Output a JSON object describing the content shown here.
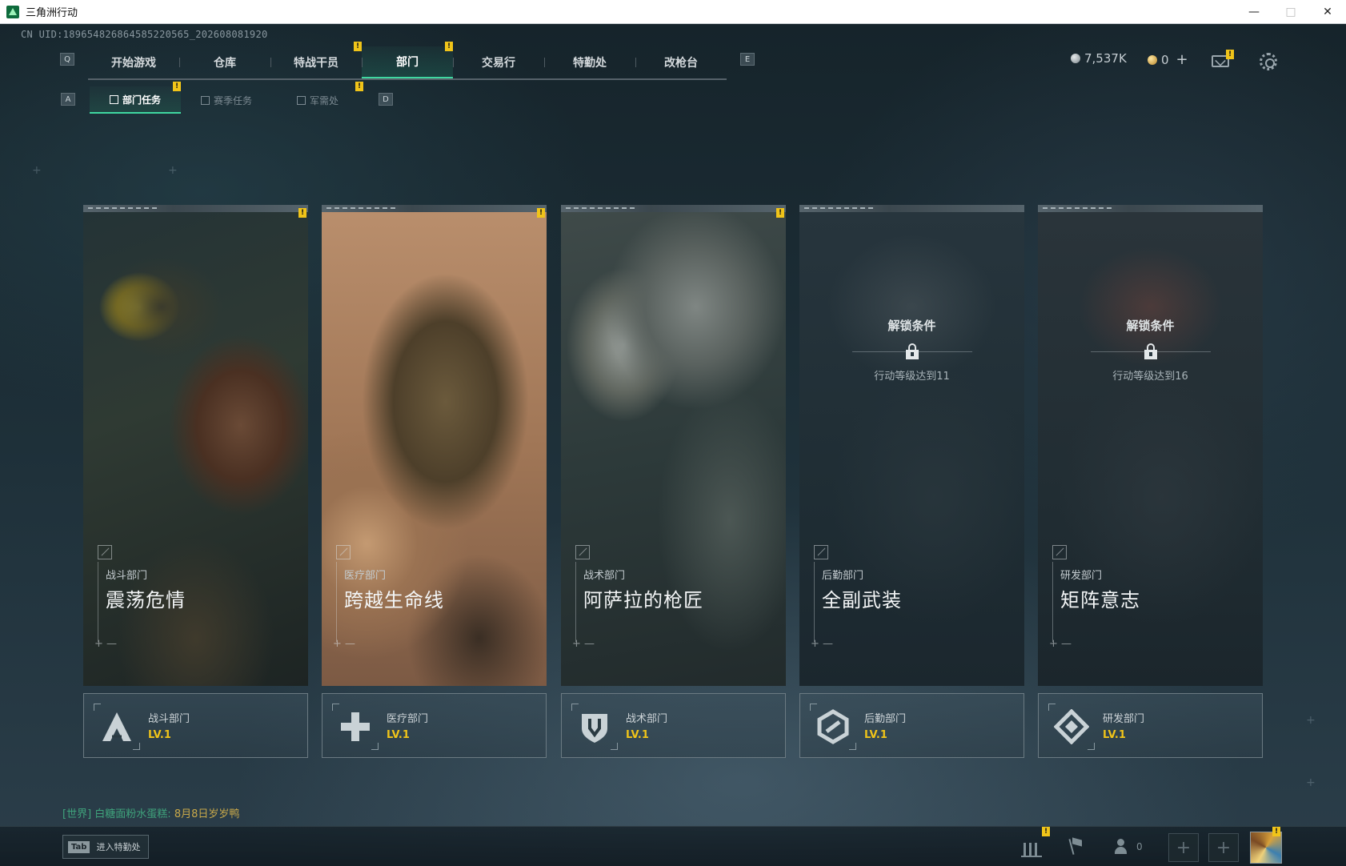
{
  "window": {
    "title": "三角洲行动",
    "minimize": "—",
    "maximize": "□",
    "close": "✕"
  },
  "uid": "CN UID:18965482686458522056​5_202608081920",
  "keys": {
    "prev_main": "Q",
    "next_main": "E",
    "prev_sub": "A",
    "next_sub": "D"
  },
  "main_nav": {
    "tabs": [
      {
        "label": "开始游戏"
      },
      {
        "label": "仓库"
      },
      {
        "label": "特战干员"
      },
      {
        "label": "部门"
      },
      {
        "label": "交易行"
      },
      {
        "label": "特勤处"
      },
      {
        "label": "改枪台"
      }
    ],
    "active_index": 3
  },
  "sub_nav": {
    "tabs": [
      {
        "label": "部门任务"
      },
      {
        "label": "赛季任务"
      },
      {
        "label": "军需处"
      }
    ],
    "active_index": 0
  },
  "badge_mark": "!",
  "currency": {
    "silver": "7,537K",
    "gold": "0",
    "add": "+"
  },
  "cards": [
    {
      "dept": "战斗部门",
      "title": "震荡危情"
    },
    {
      "dept": "医疗部门",
      "title": "跨越生命线"
    },
    {
      "dept": "战术部门",
      "title": "阿萨拉的枪匠"
    },
    {
      "dept": "后勤部门",
      "title": "全副武装",
      "lock_title": "解锁条件",
      "lock_condition": "行动等级达到11"
    },
    {
      "dept": "研发部门",
      "title": "矩阵意志",
      "lock_title": "解锁条件",
      "lock_condition": "行动等级达到16"
    }
  ],
  "levels": [
    {
      "name": "战斗部门",
      "level": "LV.1"
    },
    {
      "name": "医疗部门",
      "level": "LV.1"
    },
    {
      "name": "战术部门",
      "level": "LV.1"
    },
    {
      "name": "后勤部门",
      "level": "LV.1"
    },
    {
      "name": "研发部门",
      "level": "LV.1"
    }
  ],
  "chat": {
    "channel": "[世界]",
    "name": "白糖面粉水蛋糕:",
    "message": "8月8日岁岁鸭"
  },
  "bottom": {
    "tab_key": "Tab",
    "tab_label": "进入特勤处",
    "friend_count": "0",
    "slot_plus": "+"
  },
  "colors": {
    "accent": "#3fd7a0",
    "badge": "#f0c419",
    "level": "#f0c419"
  }
}
